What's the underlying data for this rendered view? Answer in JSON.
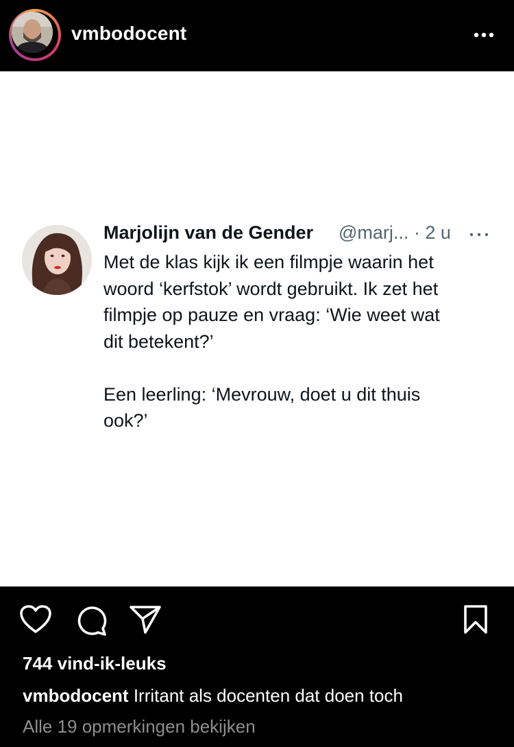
{
  "header": {
    "username": "vmbodocent",
    "avatar_icon": "profile-photo",
    "more_icon": "more-horizontal-icon"
  },
  "tweet": {
    "display_name": "Marjolijn van de Gender",
    "handle_time": "@marj... · 2 u",
    "text": "Met de klas kijk ik een filmpje waarin het\nwoord ‘kerfstok’ wordt gebruikt. Ik zet het\nfilmpje op pauze en vraag: ‘Wie weet wat\ndit betekent?’\n\nEen leerling: ‘Mevrouw, doet u dit thuis\nook?’",
    "more_icon": "more-horizontal-icon"
  },
  "actions": {
    "like_icon": "heart-icon",
    "comment_icon": "comment-icon",
    "share_icon": "send-icon",
    "save_icon": "bookmark-icon"
  },
  "likes_text": "744 vind-ik-leuks",
  "caption": {
    "username": "vmbodocent",
    "text": "Irritant als docenten dat doen toch"
  },
  "comments_link": "Alle 19 opmerkingen bekijken",
  "colors": {
    "background": "#000000",
    "text": "#ffffff",
    "muted": "#8e8e8e",
    "tweet_text": "#0f1419",
    "tweet_muted": "#536471"
  }
}
